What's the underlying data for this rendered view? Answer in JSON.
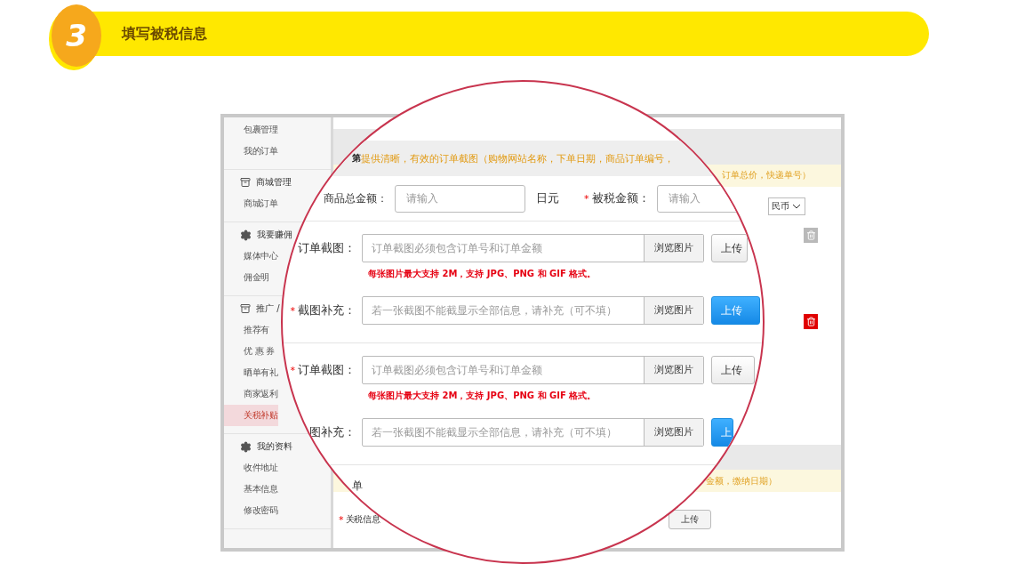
{
  "step": {
    "number": "3",
    "title": "填写被税信息"
  },
  "sidebar": {
    "groups": [
      {
        "items": [
          {
            "label": "包裹管理",
            "selected": false
          },
          {
            "label": "我的订单",
            "selected": false
          }
        ]
      },
      {
        "kind": "box",
        "title": "商城管理",
        "items": [
          {
            "label": "商城订单",
            "selected": false
          }
        ]
      },
      {
        "kind": "gear",
        "title": "我要赚佣",
        "items": [
          {
            "label": "媒体中心",
            "selected": false
          },
          {
            "label": "佣金明",
            "selected": false
          }
        ]
      },
      {
        "kind": "box",
        "title": "推广 /",
        "items": [
          {
            "label": "推荐有",
            "selected": false
          },
          {
            "label": "优 惠 券",
            "selected": false
          },
          {
            "label": "晒单有礼",
            "selected": false
          },
          {
            "label": "商家返利",
            "selected": false
          },
          {
            "label": "关税补贴",
            "selected": true
          }
        ]
      },
      {
        "kind": "gear",
        "title": "我的资料",
        "items": [
          {
            "label": "收件地址",
            "selected": false
          },
          {
            "label": "基本信息",
            "selected": false
          },
          {
            "label": "修改密码",
            "selected": false
          }
        ]
      }
    ]
  },
  "background_page": {
    "notice_top": "订单总价，快递单号）",
    "currency": "民币",
    "delete_buttons": [
      {
        "active": false
      },
      {
        "active": true
      }
    ],
    "notice_bottom": "金额，缴纳日期）",
    "customs_mark": "*",
    "customs_label": "关税信息",
    "upload": "上传"
  },
  "magnifier": {
    "notice_prefix": "第",
    "notice": "提供清晰，有效的订单截图（购物网站名称，下单日期，商品订单编号，",
    "amount_row": {
      "label": "商品总金额：",
      "placeholder": "请输入",
      "unit": "日元",
      "tax_mark": "*",
      "tax_label": "被税金额：",
      "tax_placeholder": "请输入"
    },
    "uploads": [
      {
        "label": "订单截图：",
        "placeholder": "订单截图必须包含订单号和订单金额",
        "browse": "浏览图片",
        "upload": "上传",
        "primary": false,
        "note": "每张图片最大支持 2M，支持 JPG、PNG 和 GIF 格式。"
      },
      {
        "mark": "*",
        "label": "截图补充：",
        "placeholder": "若一张截图不能截显示全部信息，请补充（可不填）",
        "browse": "浏览图片",
        "upload": "上传",
        "primary": true
      },
      {
        "mark": "*",
        "label": "订单截图：",
        "placeholder": "订单截图必须包含订单号和订单金额",
        "browse": "浏览图片",
        "upload": "上传",
        "primary": false,
        "note": "每张图片最大支持 2M，支持 JPG、PNG 和 GIF 格式。"
      },
      {
        "label": "图补充：",
        "placeholder": "若一张截图不能截显示全部信息，请补充（可不填）",
        "browse": "浏览图片",
        "upload": "上",
        "primary": true
      }
    ],
    "footer_label": "单"
  }
}
